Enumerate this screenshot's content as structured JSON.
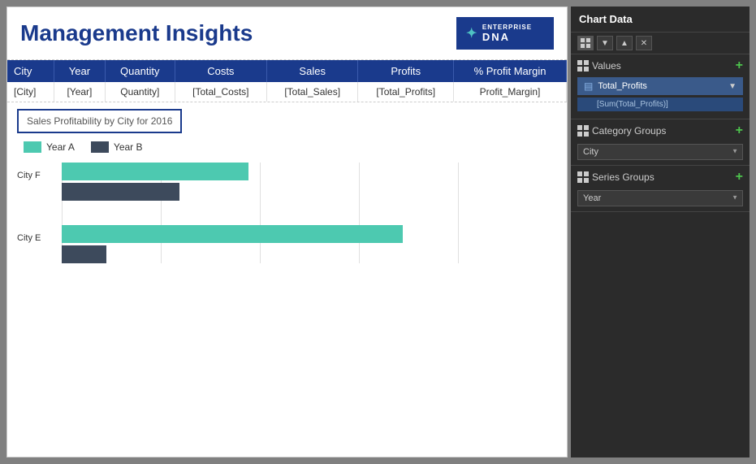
{
  "header": {
    "title": "Management Insights",
    "logo": {
      "enterprise": "ENTERPRISE",
      "dna": "DNA"
    }
  },
  "table": {
    "columns": [
      "City",
      "Year",
      "Quantity",
      "Costs",
      "Sales",
      "Profits",
      "% Profit Margin"
    ],
    "row": [
      "[City]",
      "[Year]",
      "Quantity]",
      "[Total_Costs]",
      "[Total_Sales]",
      "[Total_Profits]",
      "Profit_Margin]"
    ]
  },
  "chart": {
    "title": "Sales Profitability by City for 2016",
    "legend": {
      "year_a": "Year A",
      "year_b": "Year B"
    },
    "bars": [
      {
        "city": "City F",
        "bar_a_width": 230,
        "bar_b_width": 145
      },
      {
        "city": "City E",
        "bar_a_width": 420,
        "bar_b_width": 60
      }
    ]
  },
  "right_panel": {
    "header": "Chart Data",
    "toolbar_buttons": [
      "grid-icon",
      "down-arrow-icon",
      "up-arrow-icon",
      "close-icon"
    ],
    "values_section": {
      "title": "Values",
      "field": "Total_Profits",
      "sub_field": "[Sum(Total_Profits)]"
    },
    "category_section": {
      "title": "Category Groups",
      "field": "City"
    },
    "series_section": {
      "title": "Series Groups",
      "field": "Year"
    }
  }
}
